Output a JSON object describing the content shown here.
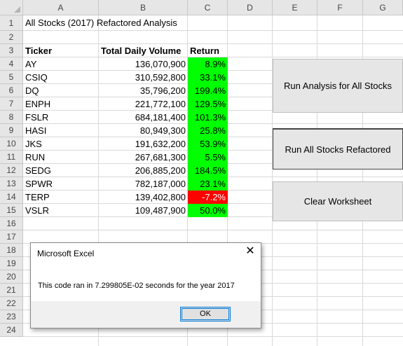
{
  "columns": [
    "A",
    "B",
    "C",
    "D",
    "E",
    "F",
    "G"
  ],
  "rows": [
    "1",
    "2",
    "3",
    "4",
    "5",
    "6",
    "7",
    "8",
    "9",
    "10",
    "11",
    "12",
    "13",
    "14",
    "15",
    "16",
    "17",
    "18",
    "19",
    "20",
    "21",
    "22",
    "23",
    "24"
  ],
  "sheet": {
    "title": "All Stocks (2017) Refactored Analysis",
    "headers": {
      "ticker": "Ticker",
      "volume": "Total Daily Volume",
      "return": "Return"
    },
    "data": [
      {
        "ticker": "AY",
        "volume": "136,070,900",
        "return": "8.9%",
        "status": "positive"
      },
      {
        "ticker": "CSIQ",
        "volume": "310,592,800",
        "return": "33.1%",
        "status": "positive"
      },
      {
        "ticker": "DQ",
        "volume": "35,796,200",
        "return": "199.4%",
        "status": "positive"
      },
      {
        "ticker": "ENPH",
        "volume": "221,772,100",
        "return": "129.5%",
        "status": "positive"
      },
      {
        "ticker": "FSLR",
        "volume": "684,181,400",
        "return": "101.3%",
        "status": "positive"
      },
      {
        "ticker": "HASI",
        "volume": "80,949,300",
        "return": "25.8%",
        "status": "positive"
      },
      {
        "ticker": "JKS",
        "volume": "191,632,200",
        "return": "53.9%",
        "status": "positive"
      },
      {
        "ticker": "RUN",
        "volume": "267,681,300",
        "return": "5.5%",
        "status": "positive"
      },
      {
        "ticker": "SEDG",
        "volume": "206,885,200",
        "return": "184.5%",
        "status": "positive"
      },
      {
        "ticker": "SPWR",
        "volume": "782,187,000",
        "return": "23.1%",
        "status": "positive"
      },
      {
        "ticker": "TERP",
        "volume": "139,402,800",
        "return": "-7.2%",
        "status": "negative"
      },
      {
        "ticker": "VSLR",
        "volume": "109,487,900",
        "return": "50.0%",
        "status": "positive"
      }
    ]
  },
  "buttons": {
    "run_all": "Run Analysis for All Stocks",
    "run_refactored": "Run All Stocks Refactored",
    "clear": "Clear Worksheet"
  },
  "dialog": {
    "title": "Microsoft Excel",
    "close_glyph": "✕",
    "message": "This code ran in 7.299805E-02 seconds for the year 2017",
    "ok_label": "OK"
  },
  "colors": {
    "positive": "#00ff00",
    "negative": "#ff0000",
    "header_bg": "#e6e6e6"
  }
}
